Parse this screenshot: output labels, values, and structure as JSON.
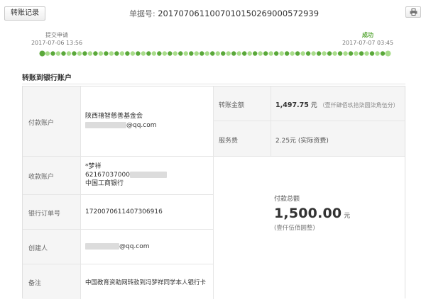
{
  "header": {
    "record_button": "转账记录",
    "doc_label": "单据号:",
    "doc_number": "2017070611007010150269000572939"
  },
  "timeline": {
    "start": {
      "label": "提交申请",
      "time": "2017-07-06 13:56"
    },
    "end": {
      "label": "成功",
      "time": "2017-07-07 03:45"
    },
    "colors": {
      "done": "#5aa83a",
      "light": "#a8dc8a"
    }
  },
  "section_title": "转账到银行账户",
  "details": {
    "payer": {
      "label": "付款账户",
      "name": "陕西禧智慈善基金会",
      "email_suffix": "@qq.com"
    },
    "payee": {
      "label": "收款账户",
      "name": "*梦祥",
      "account_prefix": "62167037000",
      "bank": "中国工商银行"
    },
    "order": {
      "label": "银行订单号",
      "value": "172007061140730691​6"
    },
    "creator": {
      "label": "创建人",
      "email_suffix": "@qq.com"
    },
    "note": {
      "label": "备注",
      "value": "中国教育资助网转款到冯梦祥同学本人银行卡"
    },
    "amount": {
      "label": "转账金额",
      "value": "1,497.75",
      "unit": "元",
      "words": "（壹仟肆佰玖拾柒圆柒角伍分）"
    },
    "fee": {
      "label": "服务费",
      "value": "2.25元 (实际资费)"
    },
    "total": {
      "label": "付款总额",
      "value": "1,500.00",
      "unit": "元",
      "words": "(壹仟伍佰圆整)"
    }
  }
}
